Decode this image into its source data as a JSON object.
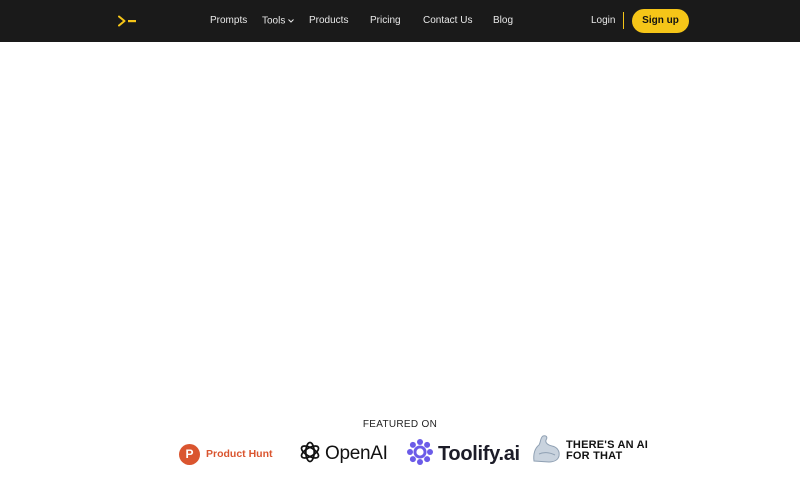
{
  "nav": {
    "logo_icon": "terminal-prompt-icon",
    "links": [
      "Prompts",
      "Tools",
      "Products",
      "Pricing",
      "Contact Us",
      "Blog"
    ],
    "login_label": "Login",
    "signup_label": "Sign up",
    "accent_color": "#f5c518",
    "background_color": "#1a1a1a"
  },
  "featured": {
    "title": "FEATURED ON",
    "logos": {
      "product_hunt": {
        "icon": "product-hunt-icon",
        "letter": "P",
        "label": "Product Hunt",
        "color": "#da552f"
      },
      "openai": {
        "icon": "openai-icon",
        "label": "OpenAI"
      },
      "toolify": {
        "icon": "toolify-icon",
        "label": "Toolify.ai",
        "color": "#6b5be8"
      },
      "taaft": {
        "icon": "robot-arm-icon",
        "line1": "THERE'S AN AI",
        "line2": "FOR THAT"
      }
    }
  }
}
